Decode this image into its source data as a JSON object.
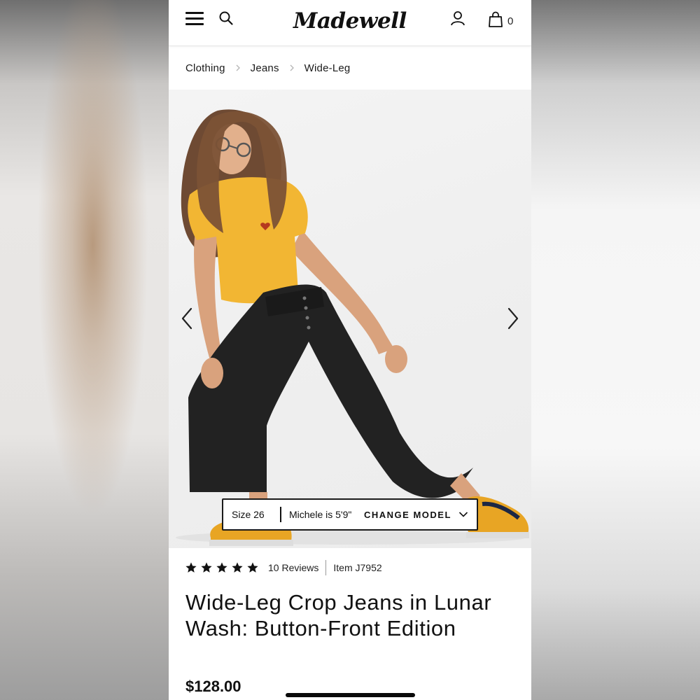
{
  "header": {
    "logo_text": "Madewell",
    "cart_count": "0",
    "icons": [
      "menu-icon",
      "search-icon",
      "account-icon",
      "shopping-bag-icon"
    ]
  },
  "breadcrumb": {
    "items": [
      "Clothing",
      "Jeans",
      "Wide-Leg"
    ]
  },
  "gallery": {
    "model_info": {
      "size": "Size 26",
      "model": "Michele is 5'9\"",
      "change_label": "CHANGE MODEL"
    },
    "icons": [
      "chevron-left-icon",
      "chevron-right-icon",
      "chevron-down-icon"
    ]
  },
  "product": {
    "rating": 5,
    "rating_max": 5,
    "reviews": "10 Reviews",
    "item_number": "Item J7952",
    "title": "Wide-Leg Crop Jeans in Lunar Wash: Button-Front Edition",
    "price": "$128.00"
  },
  "colors": {
    "text": "#111111",
    "tee_yellow": "#f2b633",
    "denim_black": "#222222",
    "background": "#ffffff"
  }
}
